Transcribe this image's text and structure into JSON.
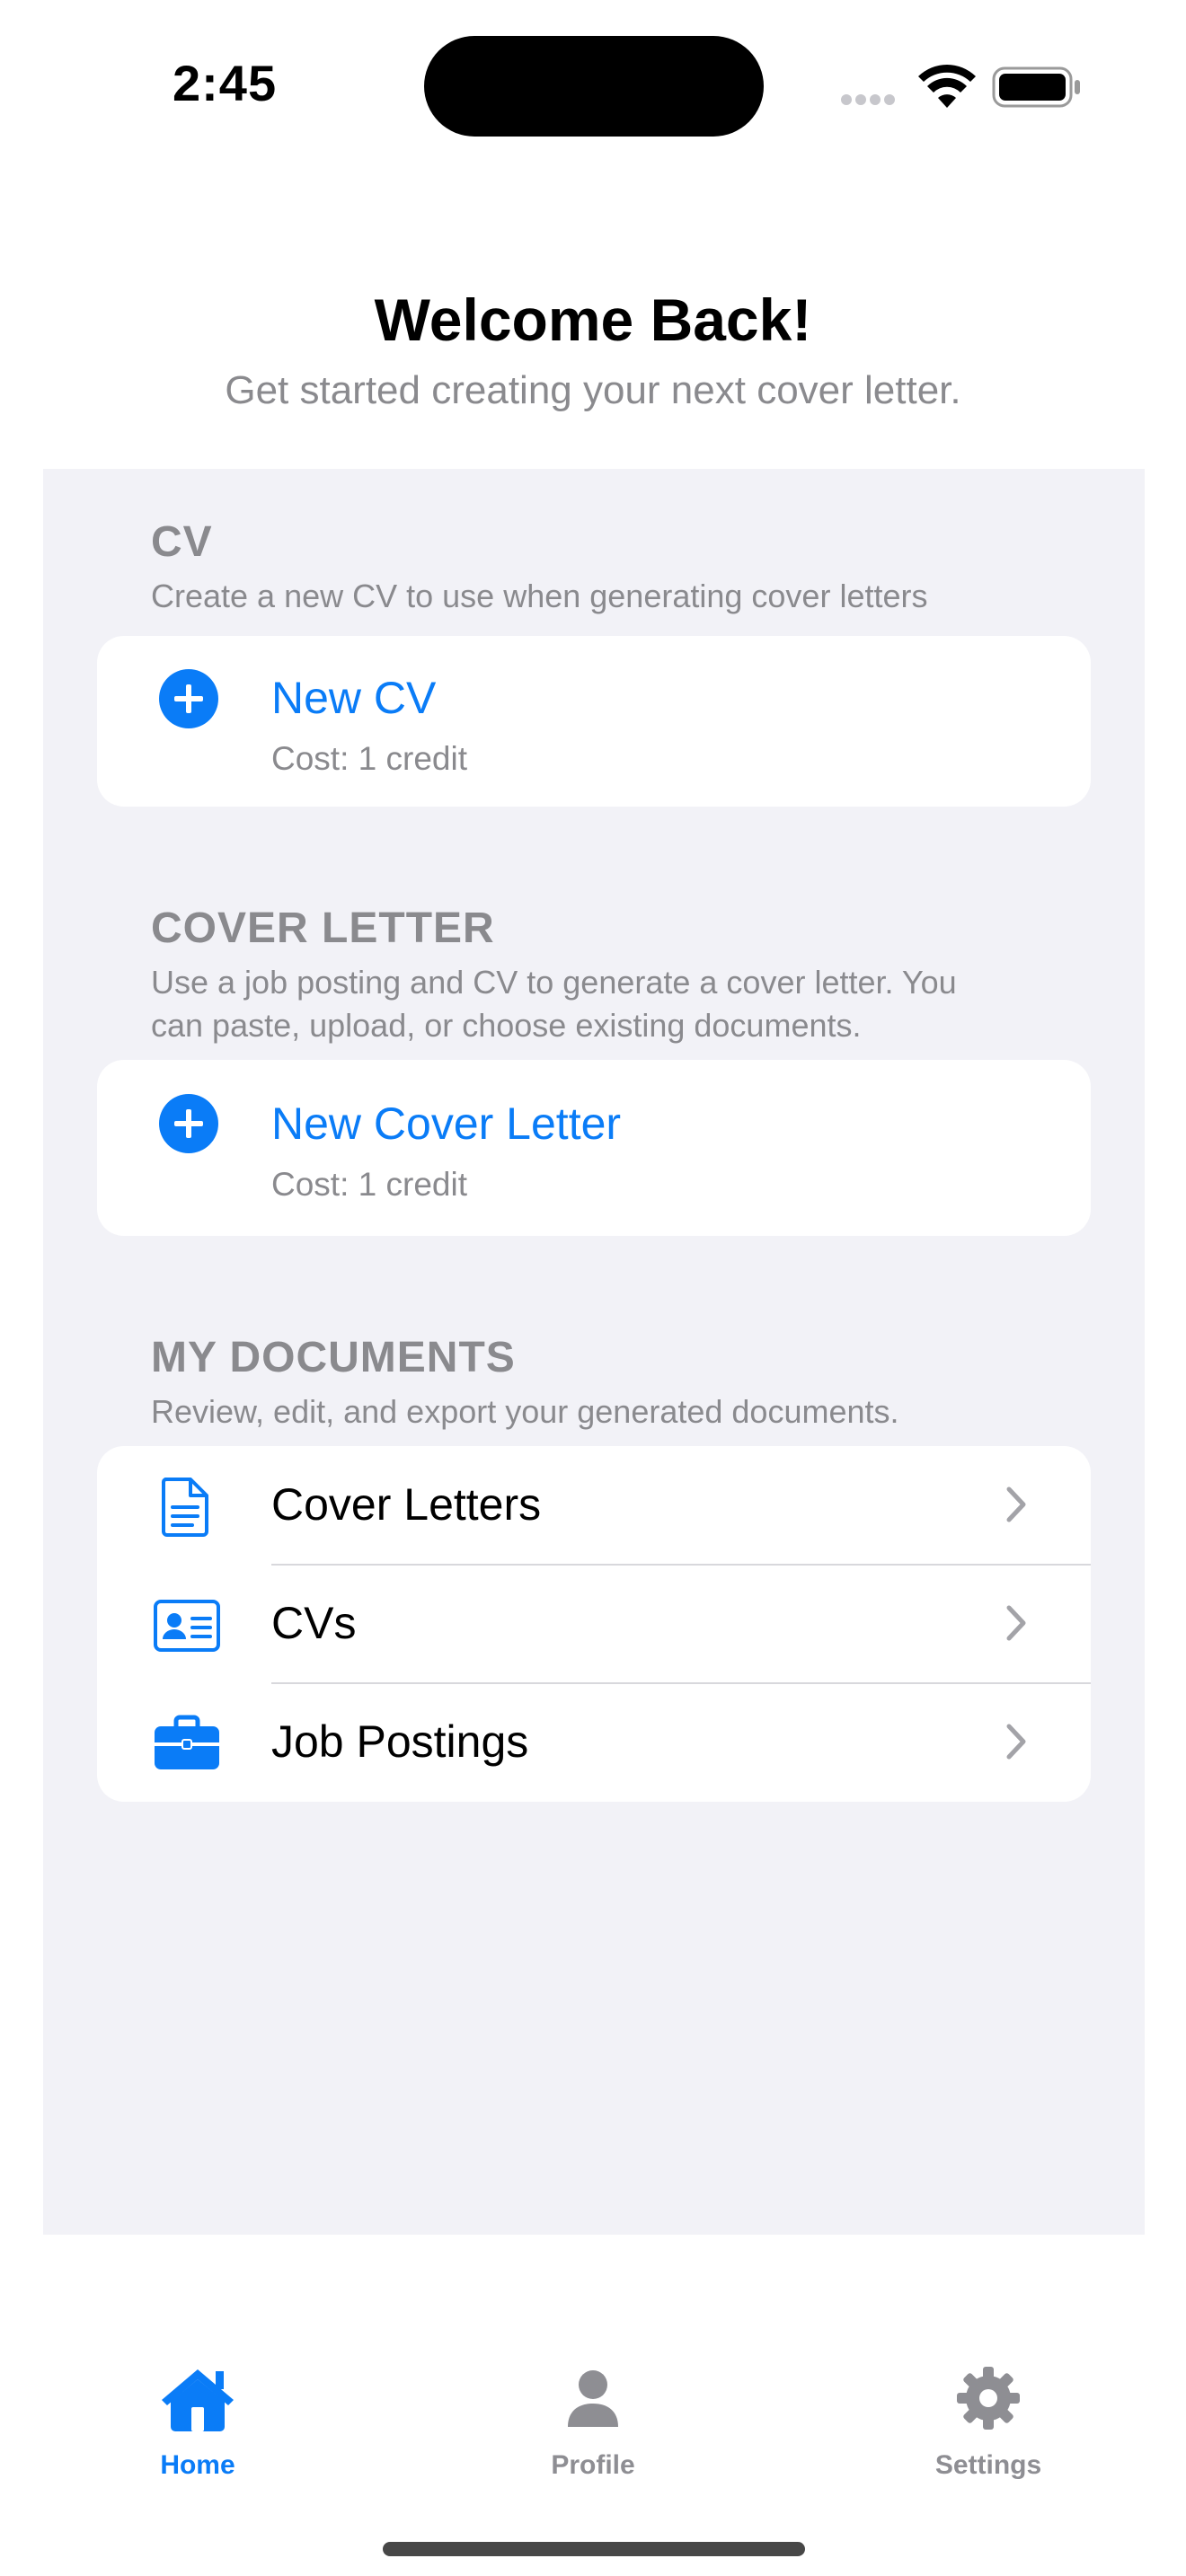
{
  "status_bar": {
    "time": "2:45"
  },
  "header": {
    "title": "Welcome Back!",
    "subtitle": "Get started creating your next cover letter."
  },
  "sections": {
    "cv": {
      "header": "CV",
      "footer": "Create a new CV to use when generating cover letters",
      "action_title": "New CV",
      "action_cost": "Cost: 1 credit"
    },
    "cover_letter": {
      "header": "COVER LETTER",
      "footer_line1": "Use a job posting and CV to generate a cover letter. You",
      "footer_line2": "can paste, upload, or choose existing documents.",
      "action_title": "New Cover Letter",
      "action_cost": "Cost: 1 credit"
    },
    "my_documents": {
      "header": "MY DOCUMENTS",
      "footer": "Review, edit, and export your generated documents.",
      "items": [
        {
          "label": "Cover Letters",
          "icon": "document-icon"
        },
        {
          "label": "CVs",
          "icon": "id-card-icon"
        },
        {
          "label": "Job Postings",
          "icon": "briefcase-icon"
        }
      ]
    }
  },
  "tab_bar": {
    "tabs": [
      {
        "label": "Home",
        "icon": "house-icon",
        "selected": true
      },
      {
        "label": "Profile",
        "icon": "person-icon",
        "selected": false
      },
      {
        "label": "Settings",
        "icon": "gear-icon",
        "selected": false
      }
    ]
  },
  "colors": {
    "accent": "#0a7cf7",
    "secondary_text": "#8a8a8e",
    "grouped_background": "#f2f2f7",
    "tab_inactive": "#8e8e93"
  }
}
